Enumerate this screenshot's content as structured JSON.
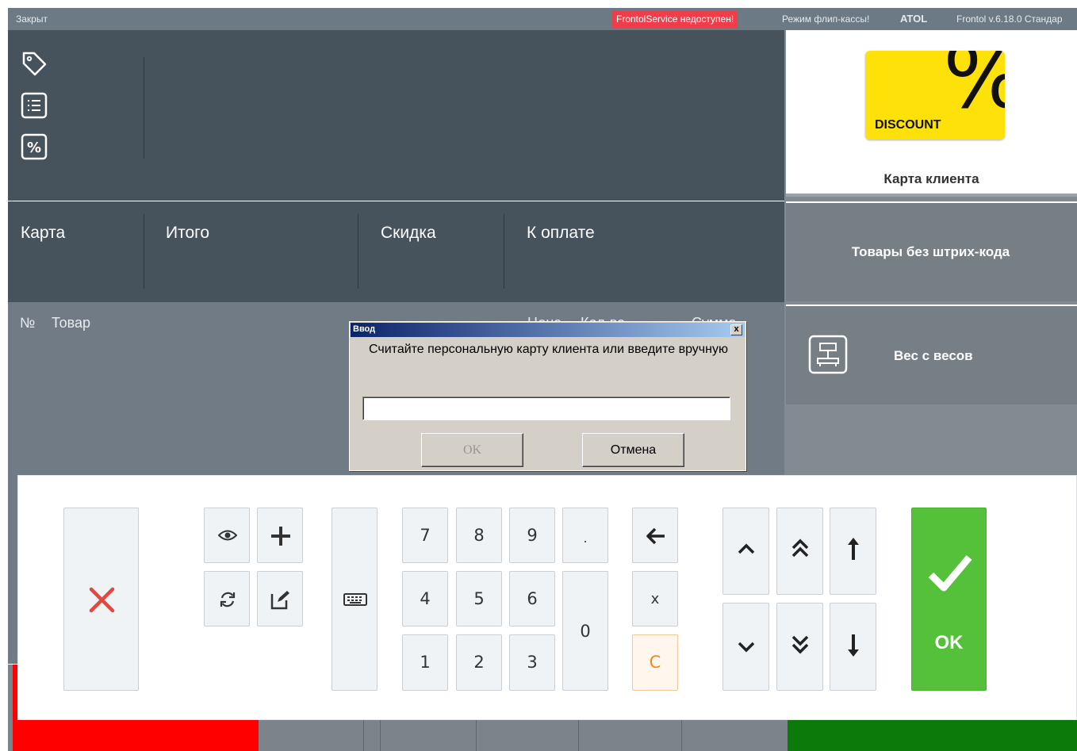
{
  "titlebar": {
    "status": "Закрыт",
    "service_warning": "FrontolService недоступен!",
    "mode": "Режим флип-кассы!",
    "brand": "ATOL",
    "version": "Frontol v.6.18.0 Стандар"
  },
  "totals": {
    "card": "Карта",
    "total": "Итого",
    "discount": "Скидка",
    "to_pay": "К оплате"
  },
  "list_header": {
    "number": "№",
    "product": "Товар",
    "price_partial": "Цена",
    "qty_partial": "Кол-во",
    "sum_partial": "Сумма"
  },
  "right_panel": {
    "discount_card_text": "DISCOUNT",
    "client_card": "Карта клиента",
    "no_barcode": "Товары без штрих-кода",
    "scale_weight": "Вес с весов"
  },
  "dialog": {
    "title": "Ввод",
    "close": "x",
    "message": "Считайте персональную карту клиента или введите вручную",
    "input_value": "",
    "ok": "OK",
    "cancel": "Отмена"
  },
  "keypad": {
    "digits": [
      "7",
      "8",
      "9",
      "4",
      "5",
      "6",
      "1",
      "2",
      "3",
      "0"
    ],
    "dot": ".",
    "multiply": "x",
    "clear": "C",
    "ok": "OK"
  },
  "colors": {
    "dark_panel": "#47535c",
    "list_panel": "#717b85",
    "warning_red": "#ef3e4a",
    "ok_green": "#55c03a",
    "cancel_red": "#e8453c",
    "discount_yellow": "#ffe10a"
  },
  "icons": [
    "tag-icon",
    "list-icon",
    "percent-icon",
    "scale-icon",
    "cancel-x-icon",
    "eye-icon",
    "plus-icon",
    "refresh-icon",
    "edit-icon",
    "keyboard-icon",
    "backspace-arrow-icon",
    "arrow-up-icon",
    "double-up-icon",
    "to-top-icon",
    "arrow-down-icon",
    "double-down-icon",
    "to-bottom-icon",
    "checkmark-icon"
  ]
}
